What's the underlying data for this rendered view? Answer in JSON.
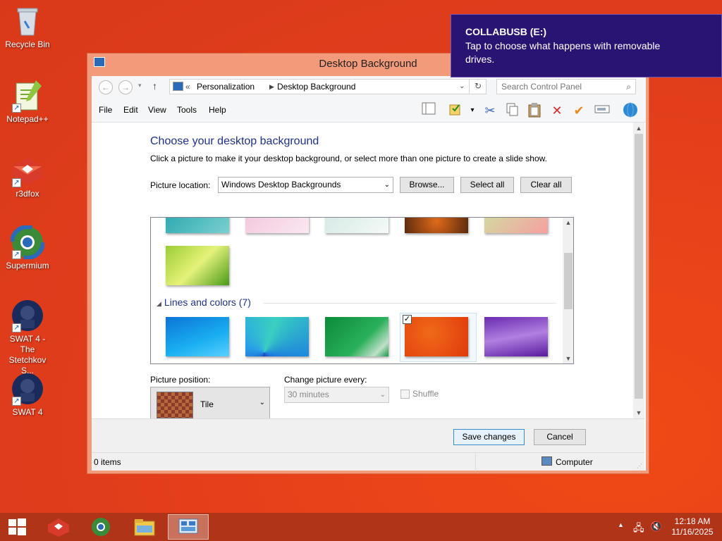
{
  "desktop": {
    "icons": [
      {
        "label": "Recycle Bin"
      },
      {
        "label": "Notepad++"
      },
      {
        "label": "r3dfox"
      },
      {
        "label": "Supermium"
      },
      {
        "label": "SWAT 4 - The Stetchkov S..."
      },
      {
        "label": "SWAT 4"
      }
    ]
  },
  "toast": {
    "title": "COLLABUSB (E:)",
    "message": "Tap to choose what happens with removable drives."
  },
  "window": {
    "title": "Desktop Background",
    "breadcrumb": {
      "prefix": "«",
      "items": [
        "Personalization",
        "Desktop Background"
      ]
    },
    "search_placeholder": "Search Control Panel",
    "menu": [
      "File",
      "Edit",
      "View",
      "Tools",
      "Help"
    ],
    "heading": "Choose your desktop background",
    "subtext": "Click a picture to make it your desktop background, or select more than one picture to create a slide show.",
    "picture_location_label": "Picture location:",
    "picture_location_value": "Windows Desktop Backgrounds",
    "buttons": {
      "browse": "Browse...",
      "select_all": "Select all",
      "clear_all": "Clear all",
      "save": "Save changes",
      "cancel": "Cancel"
    },
    "group_header": "Lines and colors (7)",
    "picture_position_label": "Picture position:",
    "picture_position_value": "Tile",
    "change_every_label": "Change picture every:",
    "change_every_value": "30 minutes",
    "shuffle_label": "Shuffle",
    "status_items": "0 items",
    "status_location": "Computer"
  },
  "taskbar": {
    "time": "12:18 AM",
    "date": "11/16/2025"
  }
}
